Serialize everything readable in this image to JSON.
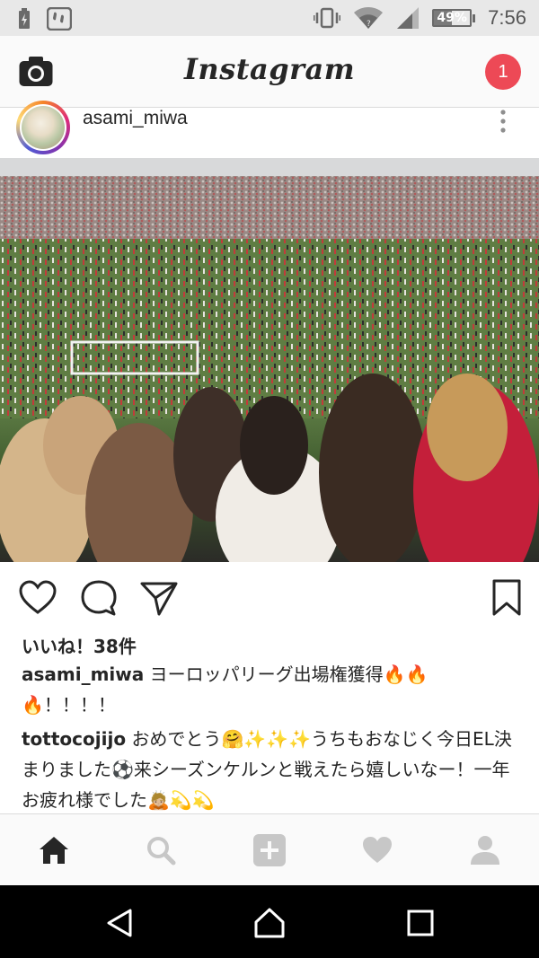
{
  "status_bar": {
    "battery_percent": "49%",
    "battery_level": 0.49,
    "time": "7:56",
    "icons": [
      "charging-icon",
      "app-notification-icon",
      "vibrate-icon",
      "wifi-icon",
      "signal-icon",
      "battery-icon"
    ]
  },
  "header": {
    "brand": "Instagram",
    "notification_count": "1",
    "icons": [
      "camera-icon"
    ]
  },
  "post": {
    "username": "asami_miwa",
    "likes": "いいね！38件",
    "caption": {
      "username": "asami_miwa",
      "text": "ヨーロッパリーグ出場権獲得",
      "emoji_fire": "🔥🔥",
      "line2_fire": "🔥",
      "line2_text": "！！！！"
    },
    "comment": {
      "username": "tottocojijo",
      "text_1": "おめでとう",
      "emoji_1": "🤗✨✨✨",
      "text_2": "うちもおなじく今日EL決まりました",
      "emoji_2": "⚽",
      "text_3": "来シーズンケルンと戦えたら嬉しいなー！一年お疲れ様でした",
      "emoji_3": "🙇🏼💫💫"
    }
  },
  "bottom_nav": {
    "items": [
      "home-icon",
      "search-icon",
      "add-icon",
      "heart-icon",
      "profile-icon"
    ]
  },
  "system_nav": {
    "items": [
      "back-icon",
      "home-icon",
      "recents-icon"
    ]
  },
  "colors": {
    "badge": "#ed4956",
    "text": "#262626",
    "nav_inactive": "#c7c7c7"
  }
}
